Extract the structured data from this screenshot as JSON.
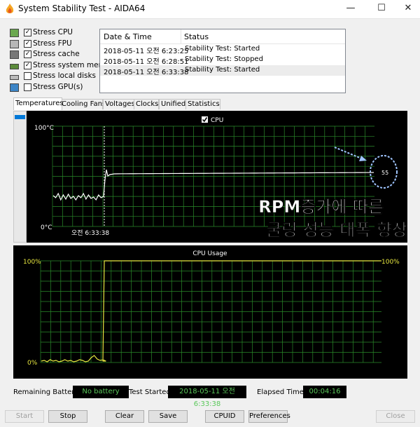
{
  "window": {
    "title": "System Stability Test - AIDA64",
    "controls": [
      "—",
      "☐",
      "✕"
    ]
  },
  "stress_options": [
    {
      "label": "Stress CPU",
      "checked": true,
      "icon": "cpu-icon"
    },
    {
      "label": "Stress FPU",
      "checked": true,
      "icon": "fpu-icon"
    },
    {
      "label": "Stress cache",
      "checked": true,
      "icon": "cache-icon"
    },
    {
      "label": "Stress system memory",
      "checked": true,
      "icon": "memory-icon"
    },
    {
      "label": "Stress local disks",
      "checked": false,
      "icon": "disk-icon"
    },
    {
      "label": "Stress GPU(s)",
      "checked": false,
      "icon": "gpu-icon"
    }
  ],
  "log": {
    "columns": [
      "Date & Time",
      "Status"
    ],
    "rows": [
      {
        "datetime": "2018-05-11 오전 6:23:25",
        "status": "Stability Test: Started"
      },
      {
        "datetime": "2018-05-11 오전 6:28:51",
        "status": "Stability Test: Stopped"
      },
      {
        "datetime": "2018-05-11 오전 6:33:38",
        "status": "Stability Test: Started"
      }
    ]
  },
  "tabs": [
    "Temperatures",
    "Cooling Fans",
    "Voltages",
    "Clocks",
    "Unified",
    "Statistics"
  ],
  "active_tab": "Temperatures",
  "temperature_graph": {
    "legend_label": "CPU",
    "y_top_label": "100°C",
    "y_bottom_label": "0°C",
    "time_marker_label": "오전 6:33:38",
    "current_value_label": "55",
    "annotation_line1": "RPM증가에 따른",
    "annotation_line2": "쿨링 성능 대폭 향상",
    "line_color": "#ffffff",
    "grid_color": "#2a8a2a",
    "annotation_color": "#9fc5ff"
  },
  "usage_graph": {
    "title": "CPU Usage",
    "y_top_left": "100%",
    "y_bottom_left": "0%",
    "y_top_right": "100%",
    "line_color": "#e8e840"
  },
  "status_bar": {
    "battery_label": "Remaining Battery:",
    "battery_value": "No battery",
    "started_label": "Test Started:",
    "started_value": "2018-05-11 오전 6:33:38",
    "elapsed_label": "Elapsed Time:",
    "elapsed_value": "00:04:16",
    "value_color": "#5ac85a"
  },
  "buttons": [
    {
      "label": "Start",
      "enabled": false
    },
    {
      "label": "Stop",
      "enabled": true
    },
    {
      "label": "Clear",
      "enabled": true
    },
    {
      "label": "Save",
      "enabled": true
    },
    {
      "label": "CPUID",
      "enabled": true
    },
    {
      "label": "Preferences",
      "enabled": true
    },
    {
      "label": "Close",
      "enabled": false
    }
  ]
}
